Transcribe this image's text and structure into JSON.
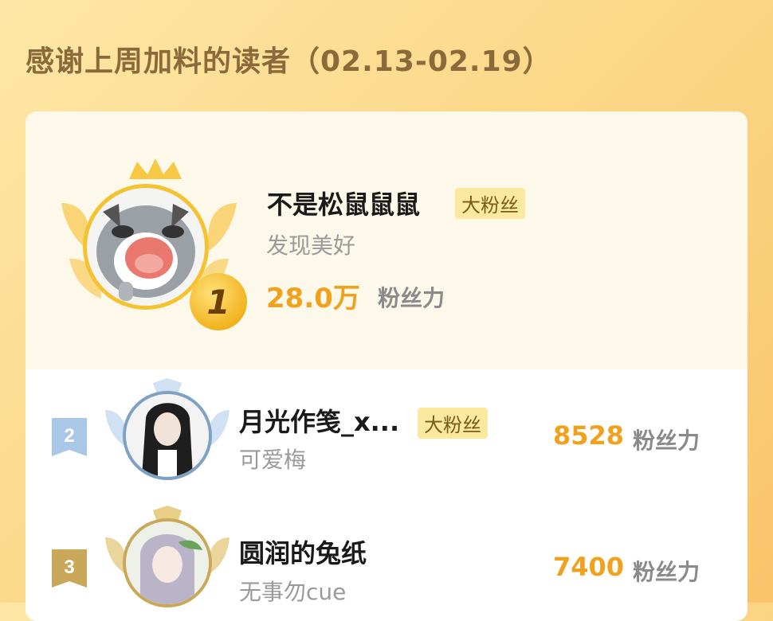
{
  "header": {
    "title": "感谢上周加料的读者（02.13-02.19）"
  },
  "readers": [
    {
      "rank": "1",
      "name": "不是松鼠鼠鼠",
      "badge": "大粉丝",
      "subtitle": "发现美好",
      "power": "28.0万",
      "power_label": "粉丝力"
    },
    {
      "rank": "2",
      "name": "月光作笺_x...",
      "badge": "大粉丝",
      "subtitle": "可爱梅",
      "power": "8528",
      "power_label": "粉丝力"
    },
    {
      "rank": "3",
      "name": "圆润的兔纸",
      "badge": "",
      "subtitle": "无事勿cue",
      "power": "7400",
      "power_label": "粉丝力"
    }
  ],
  "colors": {
    "accent": "#f0a21e",
    "gold": "#f2c23a",
    "silver": "#a9c8e8",
    "bronze": "#c9a85a"
  }
}
